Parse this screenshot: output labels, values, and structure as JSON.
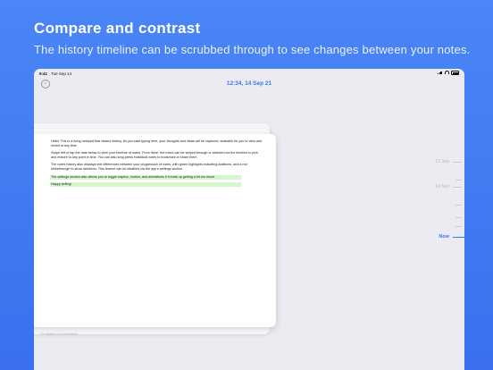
{
  "headline": "Compare and contrast",
  "subline": "The history timeline can be scrubbed through to see changes between your notes.",
  "status_bar": {
    "time": "9:41",
    "date": "Tue Sep 14"
  },
  "nav": {
    "title": "12:34, 14 Sep 21",
    "back_icon": "chevron-left-circle-icon"
  },
  "note": {
    "paragraphs": [
      "Hello! This is a living notepad that retains history. As you start typing here, your thoughts and ideas will be captured, available for you to view and revisit at any time.",
      "Swipe left or tap the date below to view your timeline of notes. From there, the notes can be swiped through or selected via the timeline to pick and restore to any point in time. You can also long-press individual notes to bookmark or share them.",
      "The notes history also displays text differences between your progression of notes, with green highlights indicating additions, and a red strikethrough to show deletions. This feature can be disabled via the app's settings section.",
      "The settings section also allows you to toggle haptics, motion, and animations if it ends up getting a bit too much.",
      "Happy writing!"
    ],
    "meta": "75 additions   0 deletions"
  },
  "timeline": {
    "label_1": "13 Sep",
    "label_2": "14 Sep",
    "now_label": "Now"
  },
  "colors": {
    "accent": "#3478f6",
    "background": "#4a86f7",
    "addition": "#d4f6cc"
  }
}
